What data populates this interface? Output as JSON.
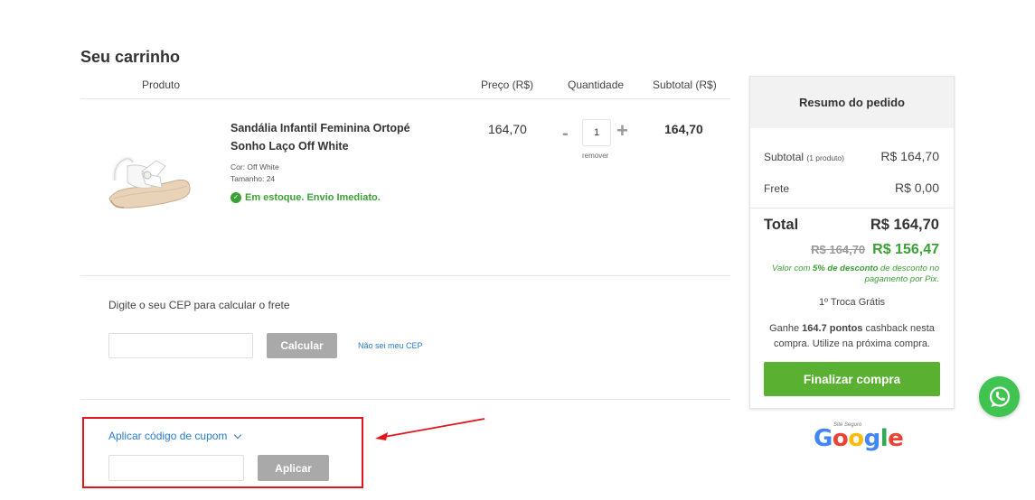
{
  "page": {
    "title": "Seu carrinho"
  },
  "cart_header": {
    "produto": "Produto",
    "preco": "Preço (R$)",
    "quantidade": "Quantidade",
    "subtotal": "Subtotal (R$)"
  },
  "product": {
    "name": "Sandália Infantil Feminina Ortopé Sonho Laço Off White",
    "cor": "Cor: Off White",
    "tamanho": "Tamanho: 24",
    "stock": "Em estoque. Envio Imediato.",
    "price": "164,70",
    "quantity": "1",
    "minus": "-",
    "plus": "+",
    "remove": "remover",
    "subtotal": "164,70"
  },
  "cep": {
    "label": "Digite o seu CEP para calcular o frete",
    "button": "Calcular",
    "link": "Não sei meu CEP",
    "placeholder": ""
  },
  "coupon": {
    "toggle": "Aplicar código de cupom",
    "button": "Aplicar",
    "placeholder": ""
  },
  "summary": {
    "title": "Resumo do pedido",
    "subtotal_label": "Subtotal",
    "subtotal_count": "(1 produto)",
    "subtotal_value": "R$ 164,70",
    "frete_label": "Frete",
    "frete_value": "R$ 0,00",
    "total_label": "Total",
    "total_value": "R$ 164,70",
    "old_price": "R$ 164,70",
    "pix_price": "R$ 156,47",
    "pix_note_prefix": "Valor com",
    "pix_note_bold": "5% de desconto",
    "pix_note_suffix": "de desconto no pagamento por Pix.",
    "troca": "1º Troca Grátis",
    "cashback_prefix": "Ganhe",
    "cashback_bold": "164.7 pontos",
    "cashback_suffix": "cashback nesta compra. Utilize na próxima compra.",
    "finalize_button": "Finalizar compra"
  },
  "seal": {
    "small": "Site Seguro",
    "word": "Google"
  },
  "colors": {
    "accent_green": "#5ab031",
    "stock_green": "#3ba035",
    "link_blue": "#2a7bd1",
    "highlight_red": "#e3141b",
    "whatsapp_green": "#40c351"
  },
  "icons": {
    "whatsapp": "whatsapp-icon",
    "stock": "check-circle-icon",
    "chevron": "chevron-down-icon"
  }
}
